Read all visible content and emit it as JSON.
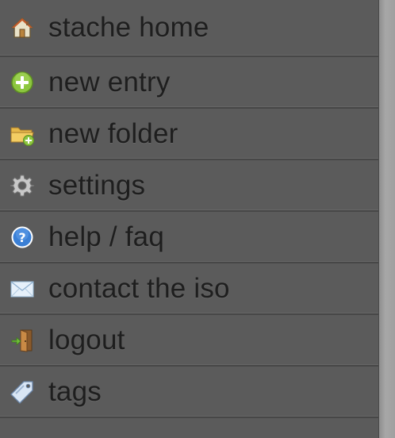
{
  "menu": {
    "items": [
      {
        "label": "stache home",
        "icon": "home-icon"
      },
      {
        "label": "new entry",
        "icon": "plus-circle-icon"
      },
      {
        "label": "new folder",
        "icon": "new-folder-icon"
      },
      {
        "label": "settings",
        "icon": "gear-icon"
      },
      {
        "label": "help / faq",
        "icon": "question-circle-icon"
      },
      {
        "label": "contact the iso",
        "icon": "envelope-icon"
      },
      {
        "label": "logout",
        "icon": "door-exit-icon"
      },
      {
        "label": "tags",
        "icon": "tag-icon"
      }
    ]
  },
  "colors": {
    "panel_background": "#5b5b5b",
    "text": "#1e1e1e",
    "divider": "#474747",
    "plus_green": "#8cc63f",
    "help_blue": "#3a7fd5"
  }
}
